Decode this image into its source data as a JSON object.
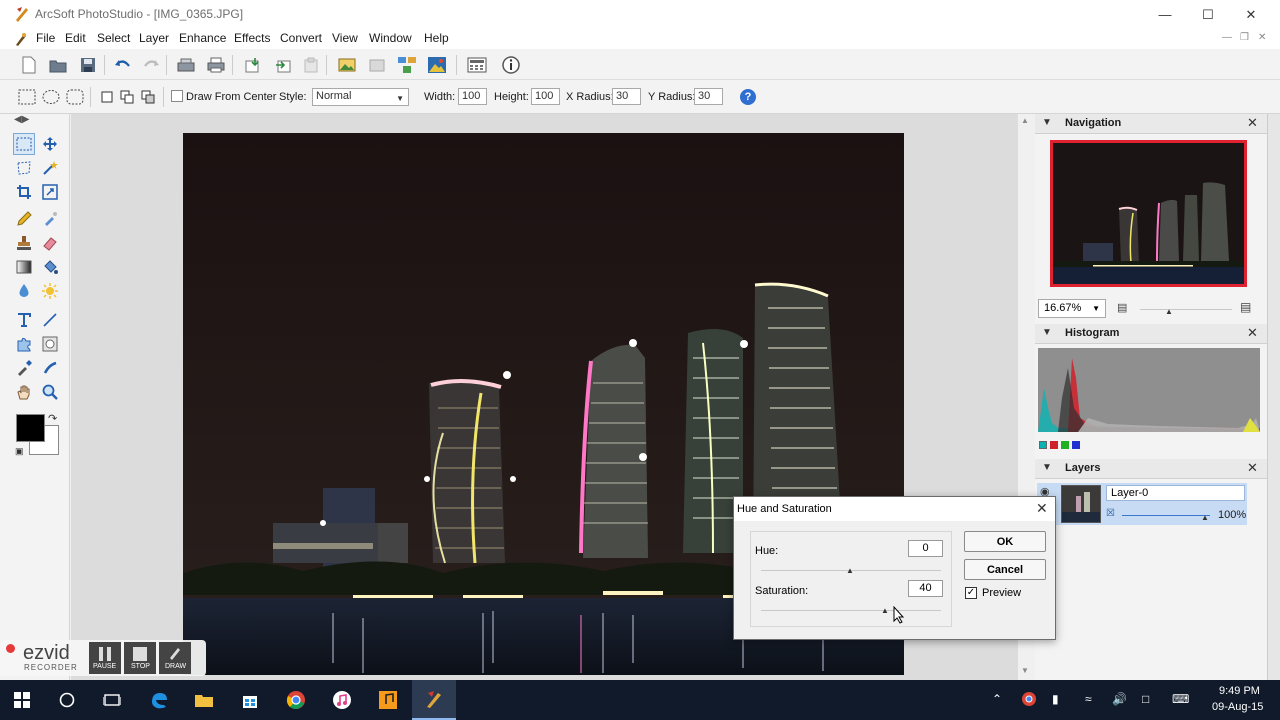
{
  "window": {
    "title": "ArcSoft PhotoStudio - [IMG_0365.JPG]"
  },
  "menu": [
    "File",
    "Edit",
    "Select",
    "Layer",
    "Enhance",
    "Effects",
    "Convert",
    "View",
    "Window",
    "Help"
  ],
  "options": {
    "draw_from_center": "Draw From Center",
    "style_label": "Style:",
    "style_value": "Normal",
    "width_label": "Width:",
    "width_value": "100",
    "height_label": "Height:",
    "height_value": "100",
    "xradius_label": "X Radius:",
    "xradius_value": "30",
    "yradius_label": "Y Radius:",
    "yradius_value": "30"
  },
  "panels": {
    "navigation": {
      "title": "Navigation",
      "zoom": "16.67%"
    },
    "histogram": {
      "title": "Histogram"
    },
    "layers": {
      "title": "Layers",
      "layer_name": "Layer-0",
      "opacity": "100%"
    }
  },
  "dialog": {
    "title": "Hue and Saturation",
    "hue_label": "Hue:",
    "hue_value": "0",
    "saturation_label": "Saturation:",
    "saturation_value": "40",
    "ok_label": "OK",
    "cancel_label": "Cancel",
    "preview_label": "Preview",
    "preview_checked": true
  },
  "ezvid": {
    "logo": "ezvid",
    "sub": "RECORDER",
    "pause": "PAUSE",
    "stop": "STOP",
    "draw": "DRAW"
  },
  "taskbar": {
    "time": "9:49 PM",
    "date": "09-Aug-15"
  },
  "colors": {
    "accent": "#1a6fd1",
    "taskbar": "#101a2a",
    "nav_frame": "#e0212f",
    "layer_selected": "#c7dcf4"
  }
}
